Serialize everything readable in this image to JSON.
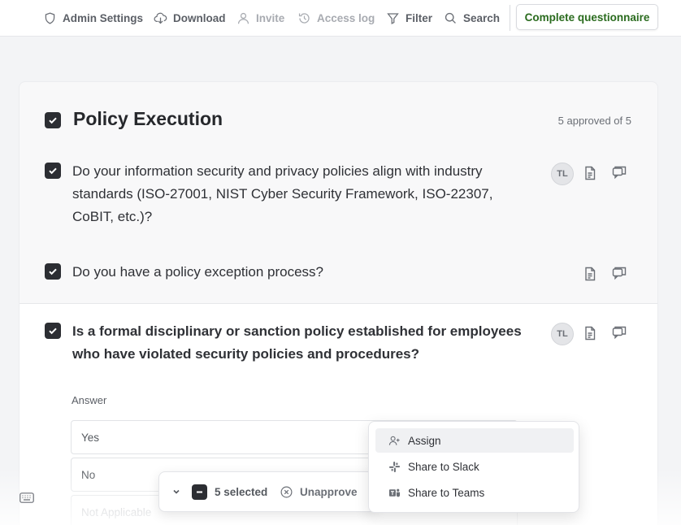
{
  "toolbar": {
    "items": [
      {
        "label": "Admin Settings",
        "icon": "shield-icon",
        "disabled": false
      },
      {
        "label": "Download",
        "icon": "cloud-download-icon",
        "disabled": false
      },
      {
        "label": "Invite",
        "icon": "user-icon",
        "disabled": true
      },
      {
        "label": "Access log",
        "icon": "history-icon",
        "disabled": true
      },
      {
        "label": "Filter",
        "icon": "filter-icon",
        "disabled": false
      },
      {
        "label": "Search",
        "icon": "search-icon",
        "disabled": false
      }
    ],
    "complete_label": "Complete questionnaire"
  },
  "section": {
    "title": "Policy Execution",
    "approved_text": "5 approved of 5"
  },
  "questions": [
    {
      "text": "Do your information security and privacy policies align with industry standards (ISO-27001, NIST Cyber Security Framework, ISO-22307, CoBIT, etc.)?",
      "assignee": "TL"
    },
    {
      "text": "Do you have a policy exception process?",
      "assignee": ""
    },
    {
      "text": "Is a formal disciplinary or sanction policy established for employees who have violated security policies and procedures?",
      "assignee": "TL"
    }
  ],
  "answer": {
    "label": "Answer",
    "options": [
      "Yes",
      "No",
      "Not Applicable"
    ]
  },
  "selection_bar": {
    "selected_text": "5 selected",
    "unapprove_label": "Unapprove"
  },
  "menu": {
    "items": [
      {
        "label": "Assign",
        "icon": "assign-user-icon"
      },
      {
        "label": "Share to Slack",
        "icon": "slack-icon"
      },
      {
        "label": "Share to Teams",
        "icon": "teams-icon"
      }
    ]
  },
  "colors": {
    "accent_green": "#2a6b1e",
    "checkbox": "#2c2e33"
  }
}
